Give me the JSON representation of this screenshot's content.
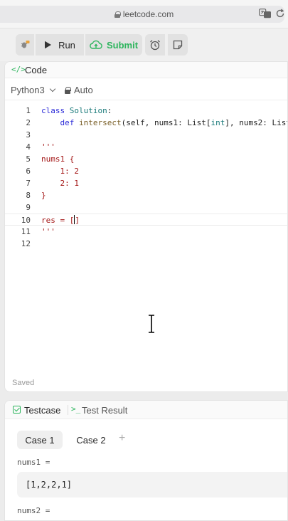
{
  "browser": {
    "url": "leetcode.com"
  },
  "toolbar": {
    "run_label": "Run",
    "submit_label": "Submit"
  },
  "code_panel": {
    "tab_label": "Code",
    "language": "Python3",
    "mode": "Auto",
    "line_numbers": [
      "1",
      "2",
      "3",
      "4",
      "5",
      "6",
      "7",
      "8",
      "9",
      "10",
      "11",
      "12"
    ],
    "status": "Saved"
  },
  "testcase_panel": {
    "testcase_label": "Testcase",
    "result_label": "Test Result",
    "cases": [
      "Case 1",
      "Case 2"
    ],
    "params": [
      {
        "name": "nums1 =",
        "value": "[1,2,2,1]"
      },
      {
        "name": "nums2 ="
      }
    ]
  },
  "colors": {
    "accent_green": "#2db55d"
  }
}
